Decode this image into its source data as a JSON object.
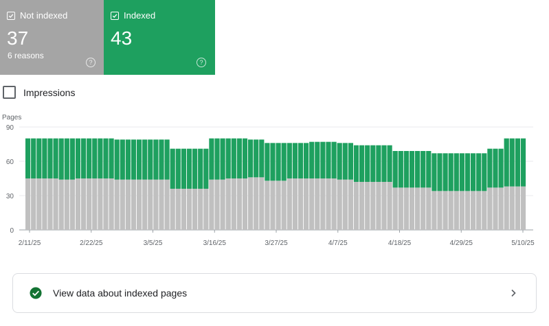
{
  "cards": {
    "not_indexed": {
      "label": "Not indexed",
      "count": "37",
      "sub": "6 reasons",
      "help": "?",
      "color": "#a5a5a5",
      "checked": true
    },
    "indexed": {
      "label": "Indexed",
      "count": "43",
      "help": "?",
      "color": "#1ea05f",
      "checked": true
    }
  },
  "impressions": {
    "label": "Impressions",
    "checked": false
  },
  "bottom_card": {
    "label": "View data about indexed pages",
    "icon": "check-circle-icon",
    "chevron": "chevron-right-icon"
  },
  "chart_data": {
    "type": "bar",
    "stacked": true,
    "ylabel": "Pages",
    "ylim": [
      0,
      90
    ],
    "yticks": [
      0,
      30,
      60,
      90
    ],
    "xtick_labels": [
      "2/11/25",
      "2/22/25",
      "3/5/25",
      "3/16/25",
      "3/27/25",
      "4/7/25",
      "4/18/25",
      "4/29/25",
      "5/10/25"
    ],
    "grid": true,
    "colors": {
      "not_indexed": "#c0c0c0",
      "indexed": "#1ea05f"
    },
    "series": [
      {
        "name": "Not indexed",
        "values": [
          45,
          45,
          45,
          45,
          45,
          45,
          44,
          44,
          44,
          45,
          45,
          45,
          45,
          45,
          45,
          45,
          44,
          44,
          44,
          44,
          44,
          44,
          44,
          44,
          44,
          44,
          36,
          36,
          36,
          36,
          36,
          36,
          36,
          44,
          44,
          44,
          45,
          45,
          45,
          45,
          46,
          46,
          46,
          43,
          43,
          43,
          43,
          45,
          45,
          45,
          45,
          45,
          45,
          45,
          45,
          45,
          44,
          44,
          44,
          42,
          42,
          42,
          42,
          42,
          42,
          42,
          37,
          37,
          37,
          37,
          37,
          37,
          37,
          34,
          34,
          34,
          34,
          34,
          34,
          34,
          34,
          34,
          34,
          37,
          37,
          37,
          38,
          38,
          38,
          38
        ]
      },
      {
        "name": "Indexed",
        "values": [
          35,
          35,
          35,
          35,
          35,
          35,
          36,
          36,
          36,
          35,
          35,
          35,
          35,
          35,
          35,
          35,
          35,
          35,
          35,
          35,
          35,
          35,
          35,
          35,
          35,
          35,
          35,
          35,
          35,
          35,
          35,
          35,
          35,
          36,
          36,
          36,
          35,
          35,
          35,
          35,
          33,
          33,
          33,
          33,
          33,
          33,
          33,
          31,
          31,
          31,
          31,
          32,
          32,
          32,
          32,
          32,
          32,
          32,
          32,
          32,
          32,
          32,
          32,
          32,
          32,
          32,
          32,
          32,
          32,
          32,
          32,
          32,
          32,
          33,
          33,
          33,
          33,
          33,
          33,
          33,
          33,
          33,
          33,
          34,
          34,
          34,
          42,
          42,
          42,
          42
        ]
      }
    ]
  }
}
